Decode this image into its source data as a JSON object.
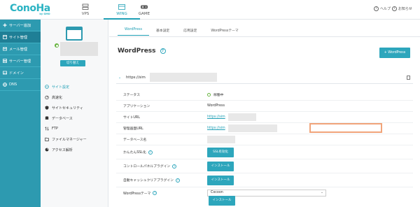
{
  "brand": {
    "name": "ConoHa",
    "sub": "by GMO"
  },
  "top_nav": [
    {
      "label": "VPS",
      "icon": "server-icon"
    },
    {
      "label": "WING",
      "icon": "wing-icon",
      "active": true
    },
    {
      "label": "GAME",
      "icon": "gamepad-icon"
    }
  ],
  "top_right": {
    "help": "ヘルプ",
    "notice": "お知らせ"
  },
  "sidebar": [
    {
      "label": "サーバー追加",
      "icon": "plus-icon"
    },
    {
      "label": "サイト管理",
      "icon": "site-icon",
      "active": true
    },
    {
      "label": "メール管理",
      "icon": "mail-icon"
    },
    {
      "label": "サーバー管理",
      "icon": "server-icon"
    },
    {
      "label": "ドメイン",
      "icon": "domain-icon"
    },
    {
      "label": "DNS",
      "icon": "globe-icon"
    }
  ],
  "subpanel": {
    "switch_label": "切り替え",
    "items": [
      {
        "label": "サイト設定",
        "icon": "globe-icon",
        "active": true
      },
      {
        "label": "高速化",
        "icon": "speed-icon"
      },
      {
        "label": "サイトセキュリティ",
        "icon": "shield-icon"
      },
      {
        "label": "データベース",
        "icon": "database-icon"
      },
      {
        "label": "FTP",
        "icon": "ftp-icon"
      },
      {
        "label": "ファイルマネージャー",
        "icon": "folder-icon"
      },
      {
        "label": "アクセス解析",
        "icon": "chart-icon"
      }
    ]
  },
  "main": {
    "tabs": [
      "WordPress",
      "基本設定",
      "応用設定",
      "WordPressテーマ"
    ],
    "title": "WordPress",
    "add_button": "+ WordPress",
    "site_url_prefix": "https://sim",
    "rows": {
      "status_label": "ステータス",
      "status_value": "稼働中",
      "app_label": "アプリケーション",
      "app_value": "WordPress",
      "site_url_label": "サイトURL",
      "site_url_value": "https://sim",
      "admin_url_label": "管理画面URL",
      "admin_url_value": "https://sim",
      "db_label": "データベース名",
      "ssl_label": "かんたんSSL化",
      "ssl_button": "SSL有効化",
      "cp_plugin_label": "コントロールパネルプラグイン",
      "cp_plugin_button": "インストール",
      "cache_plugin_label": "自動キャッシュクリアプラグイン",
      "cache_plugin_button": "インストール",
      "theme_label": "WordPressテーマ",
      "theme_value": "Cocoon",
      "theme_button": "インストール"
    }
  },
  "colors": {
    "accent": "#2da6bc",
    "sidebar": "#2d9ab0",
    "highlight": "#f1a47a",
    "status": "#63b33b"
  }
}
